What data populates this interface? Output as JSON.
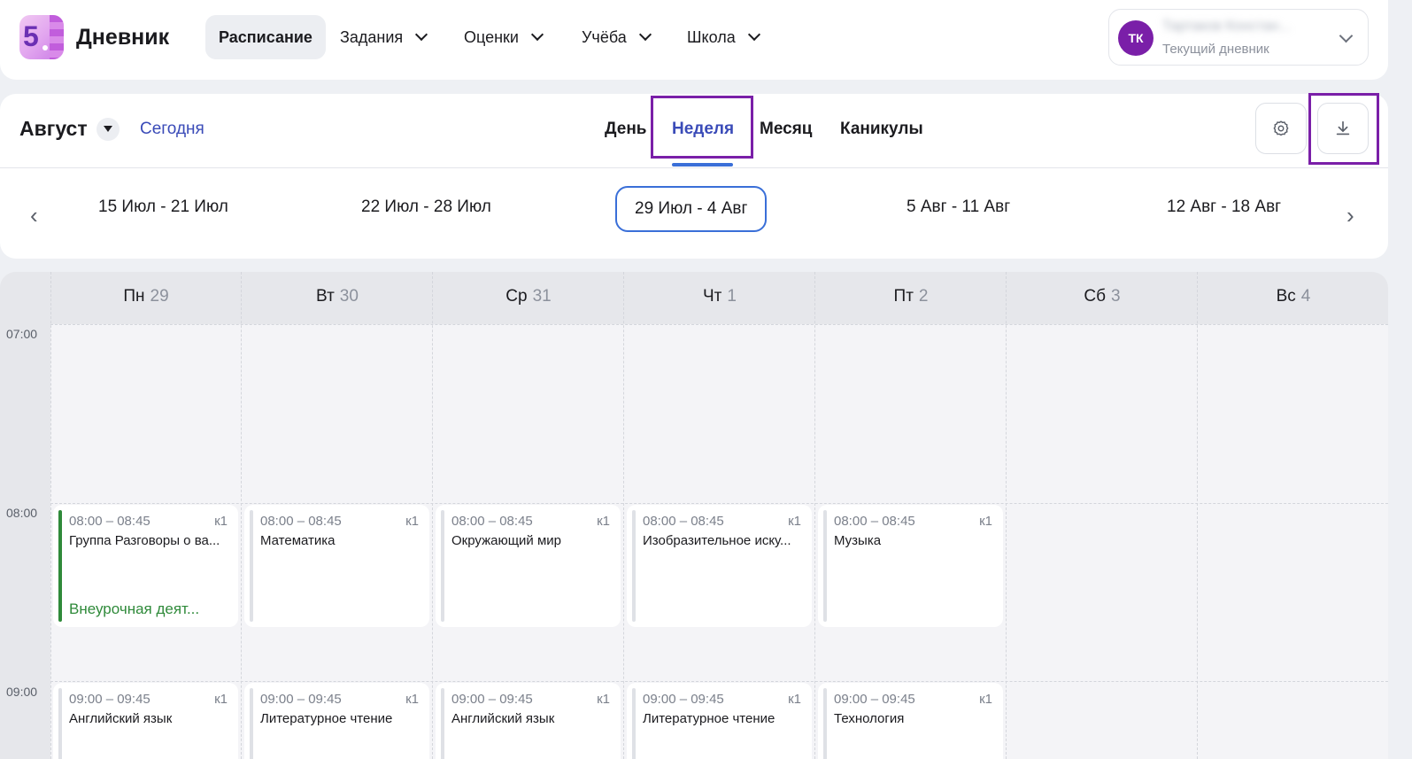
{
  "header": {
    "brand": "Дневник",
    "logo_digit": "5",
    "nav": [
      {
        "label": "Расписание",
        "active": true
      },
      {
        "label": "Задания"
      },
      {
        "label": "Оценки"
      },
      {
        "label": "Учёба"
      },
      {
        "label": "Школа"
      }
    ],
    "profile": {
      "initials": "ТК",
      "name": "Тартаков Констан...",
      "subtitle": "Текущий дневник"
    }
  },
  "controls": {
    "month": "Август",
    "today": "Сегодня",
    "views": [
      "День",
      "Неделя",
      "Месяц",
      "Каникулы"
    ],
    "active_view": "Неделя",
    "weeks": [
      "15 Июл - 21 Июл",
      "22 Июл - 28 Июл",
      "29 Июл - 4 Авг",
      "5 Авг - 11 Авг",
      "12 Авг - 18 Авг"
    ],
    "current_week": "29 Июл - 4 Авг",
    "prev_arrow": "‹",
    "next_arrow": "›"
  },
  "schedule": {
    "days": [
      {
        "name": "Пн",
        "date": "29"
      },
      {
        "name": "Вт",
        "date": "30"
      },
      {
        "name": "Ср",
        "date": "31"
      },
      {
        "name": "Чт",
        "date": "1"
      },
      {
        "name": "Пт",
        "date": "2"
      },
      {
        "name": "Сб",
        "date": "3"
      },
      {
        "name": "Вс",
        "date": "4"
      }
    ],
    "times": [
      "07:00",
      "08:00",
      "09:00"
    ],
    "slot1": [
      {
        "time": "08:00 – 08:45",
        "room": "к1",
        "subject": "Группа Разговоры о ва...",
        "kind": "Внеурочная деят..."
      },
      {
        "time": "08:00 – 08:45",
        "room": "к1",
        "subject": "Математика"
      },
      {
        "time": "08:00 – 08:45",
        "room": "к1",
        "subject": "Окружающий мир"
      },
      {
        "time": "08:00 – 08:45",
        "room": "к1",
        "subject": "Изобразительное иску..."
      },
      {
        "time": "08:00 – 08:45",
        "room": "к1",
        "subject": "Музыка"
      }
    ],
    "slot2": [
      {
        "time": "09:00 – 09:45",
        "room": "к1",
        "subject": "Английский язык"
      },
      {
        "time": "09:00 – 09:45",
        "room": "к1",
        "subject": "Литературное чтение"
      },
      {
        "time": "09:00 – 09:45",
        "room": "к1",
        "subject": "Английский язык"
      },
      {
        "time": "09:00 – 09:45",
        "room": "к1",
        "subject": "Литературное чтение"
      },
      {
        "time": "09:00 – 09:45",
        "room": "к1",
        "subject": "Технология"
      }
    ]
  },
  "colors": {
    "accent": "#3a4bb8",
    "highlight": "#7a1fa8",
    "extracurricular": "#2f8a3a"
  }
}
